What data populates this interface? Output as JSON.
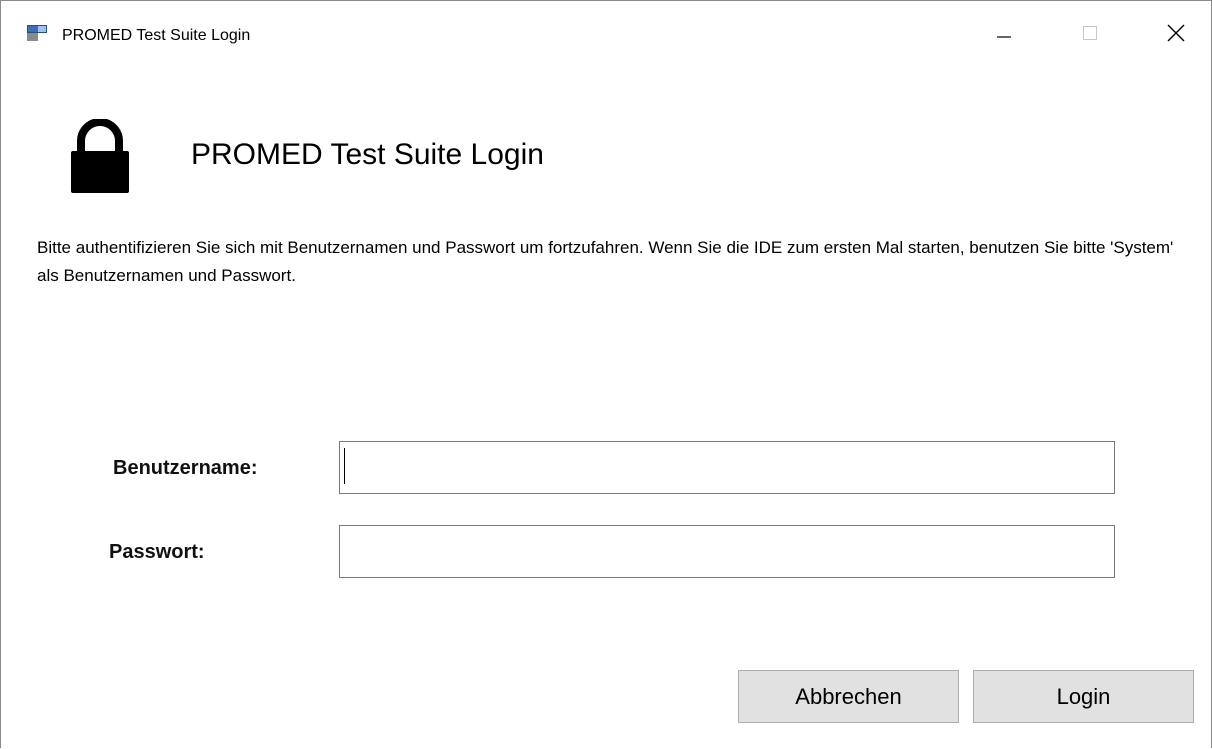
{
  "window": {
    "title": "PROMED Test Suite Login",
    "app_icon": "window-app-icon",
    "controls": {
      "minimize_icon": "minimize-icon",
      "maximize_icon": "maximize-icon",
      "close_icon": "close-icon"
    }
  },
  "header": {
    "icon": "lock-icon",
    "title": "PROMED Test Suite Login"
  },
  "description": "Bitte authentifizieren Sie sich mit Benutzernamen und Passwort um fortzufahren. Wenn Sie die IDE zum ersten Mal starten, benutzen Sie bitte 'System' als Benutzernamen und Passwort.",
  "form": {
    "username_label": "Benutzername:",
    "username_value": "",
    "password_label": "Passwort:",
    "password_value": ""
  },
  "buttons": {
    "cancel_label": "Abbrechen",
    "login_label": "Login"
  },
  "colors": {
    "button_bg": "#e1e1e1",
    "button_border": "#adadad",
    "input_border": "#7a7a7a",
    "window_bg": "#ffffff"
  }
}
